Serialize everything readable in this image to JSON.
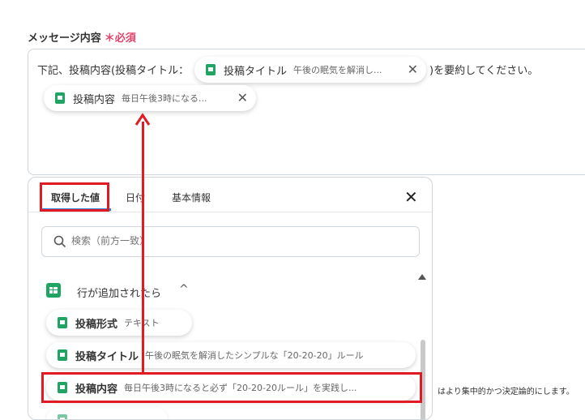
{
  "field": {
    "label": "メッセージ内容",
    "required_mark": "＊",
    "required_text": "必須"
  },
  "message": {
    "prefix": "下記、投稿内容(投稿タイトル：",
    "suffix": ")を要約してください。",
    "title_chip": {
      "title": "投稿タイトル",
      "value": "午後の眠気を解消し...",
      "close": "✕"
    },
    "content_chip": {
      "title": "投稿内容",
      "value": "毎日午後3時になる...",
      "close": "✕"
    }
  },
  "panel": {
    "tabs": [
      "取得した値",
      "日付",
      "基本情報"
    ],
    "close": "✕",
    "search_placeholder": "検索（前方一致）",
    "group": {
      "title": "行が追加されたら",
      "chevron": "^"
    },
    "items": [
      {
        "title": "投稿形式",
        "value": "テキスト"
      },
      {
        "title": "投稿タイトル",
        "value": "午後の眠気を解消したシンプルな「20-20-20」ルール"
      },
      {
        "title": "投稿内容",
        "value": "毎日午後3時になると必ず「20-20-20ルール」を実践し..."
      }
    ]
  },
  "background_note": "はより集中的かつ決定論的にします。",
  "colors": {
    "accent": "#2a7fd8",
    "highlight": "#e21a23",
    "required": "#e0436b",
    "sheet": "#1fa463"
  }
}
